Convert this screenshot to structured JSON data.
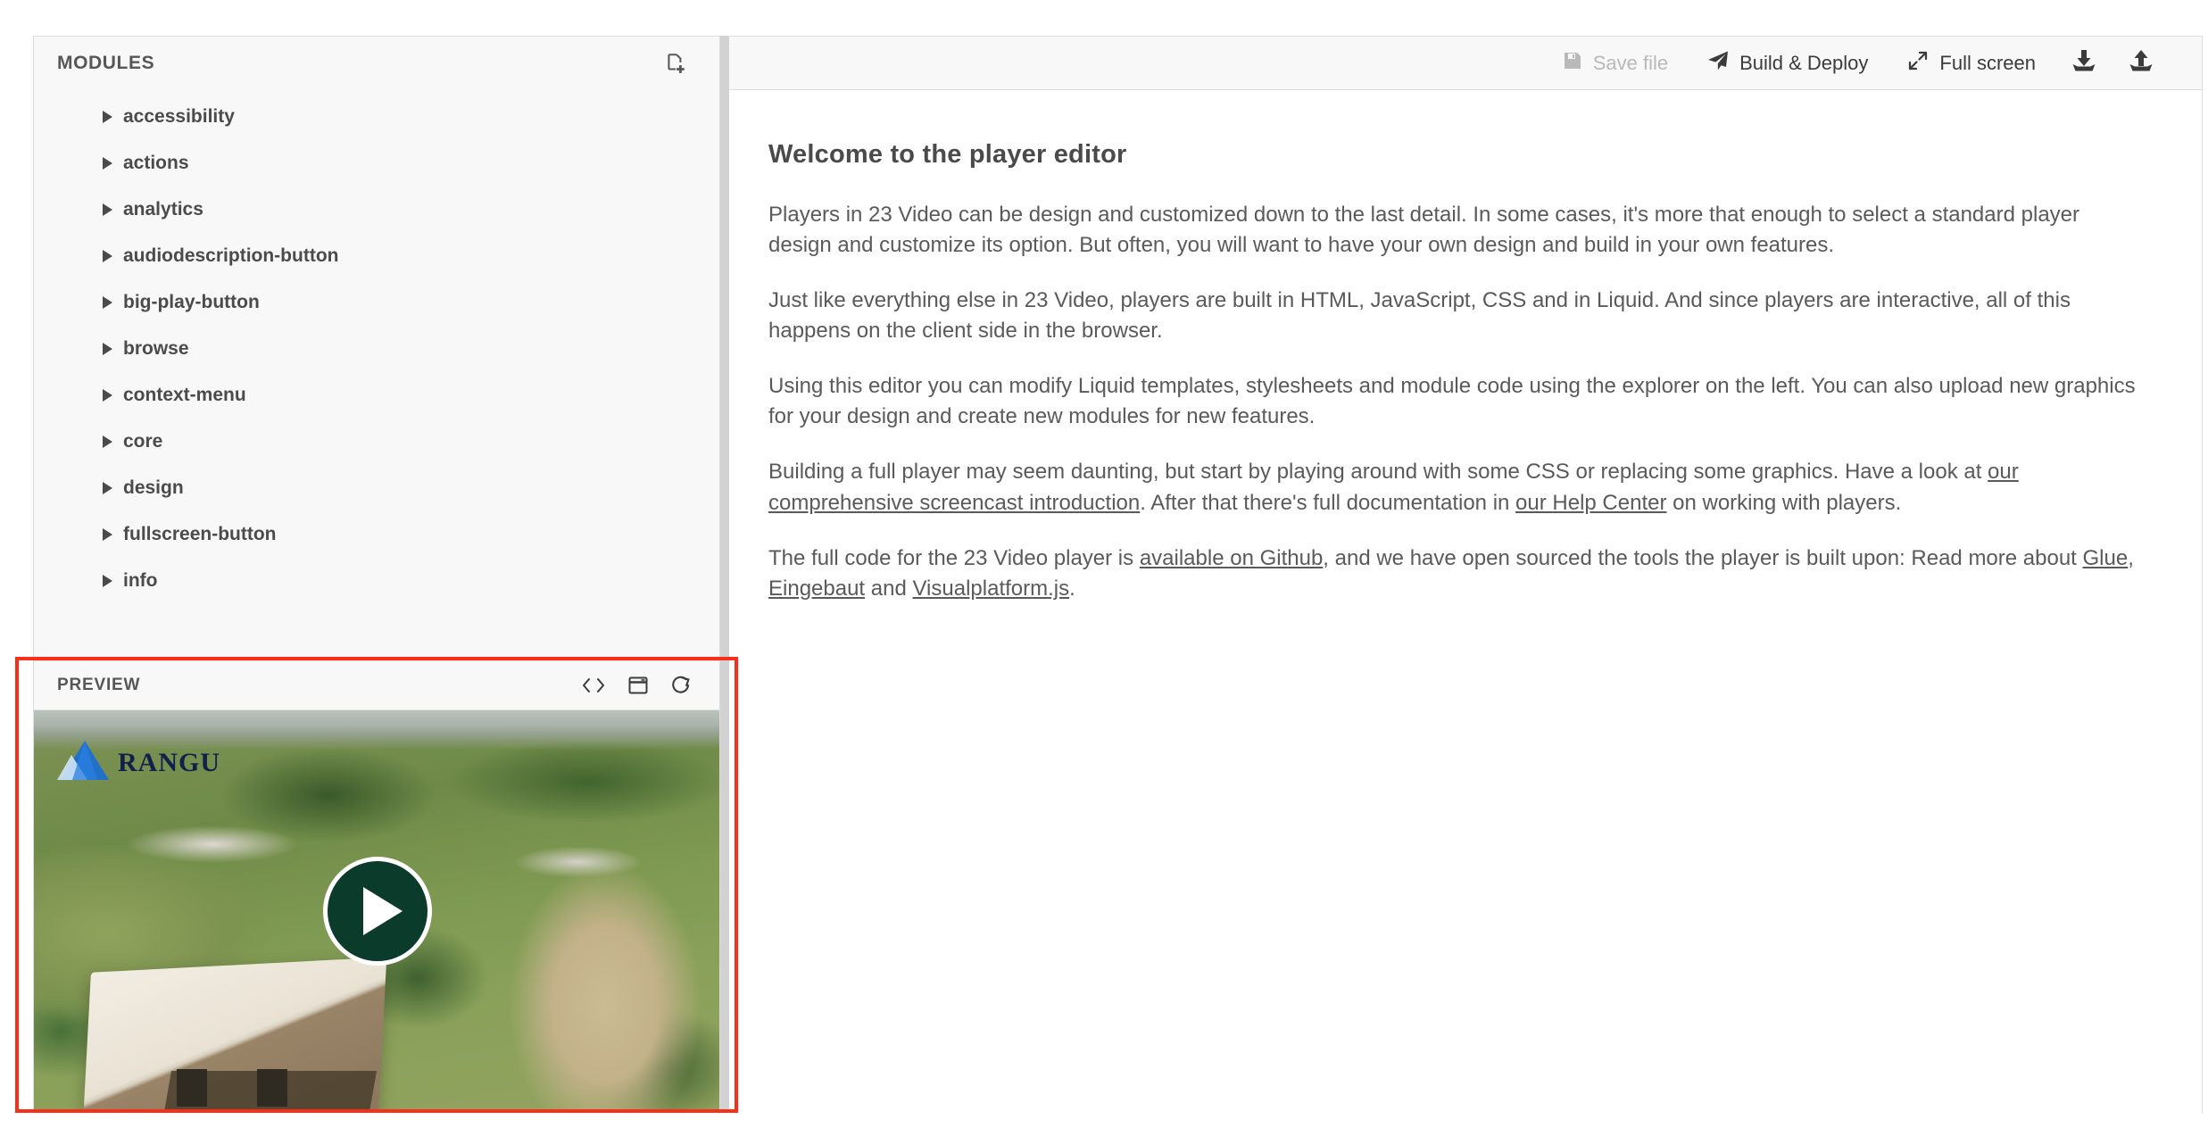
{
  "sidebar": {
    "title": "MODULES",
    "new_module_icon": "new-file-plus-icon",
    "items": [
      {
        "label": "accessibility"
      },
      {
        "label": "actions"
      },
      {
        "label": "analytics"
      },
      {
        "label": "audiodescription-button"
      },
      {
        "label": "big-play-button"
      },
      {
        "label": "browse"
      },
      {
        "label": "context-menu"
      },
      {
        "label": "core"
      },
      {
        "label": "design"
      },
      {
        "label": "fullscreen-button"
      },
      {
        "label": "info"
      }
    ]
  },
  "preview": {
    "title": "PREVIEW",
    "actions": [
      {
        "name": "view-source-icon",
        "glyph": "<>"
      },
      {
        "name": "popout-window-icon",
        "glyph": "window"
      },
      {
        "name": "refresh-icon",
        "glyph": "refresh"
      }
    ],
    "player": {
      "logo_text": "RANGU",
      "play_button_label": "Play",
      "play_button_color": "#0b3b2b"
    },
    "highlight_color": "#f8301a"
  },
  "toolbar": {
    "save_label": "Save file",
    "save_disabled": true,
    "build_label": "Build & Deploy",
    "fullscreen_label": "Full screen",
    "download_icon": "download-icon",
    "upload_icon": "upload-icon"
  },
  "document": {
    "heading": "Welcome to the player editor",
    "p1": "Players in 23 Video can be design and customized down to the last detail. In some cases, it's more that enough to select a standard player design and customize its option. But often, you will want to have your own design and build in your own features.",
    "p2": "Just like everything else in 23 Video, players are built in HTML, JavaScript, CSS and in Liquid. And since players are interactive, all of this happens on the client side in the browser.",
    "p3": "Using this editor you can modify Liquid templates, stylesheets and module code using the explorer on the left. You can also upload new graphics for your design and create new modules for new features.",
    "p4_a": "Building a full player may seem daunting, but start by playing around with some CSS or replacing some graphics. Have a look at ",
    "p4_link1": "our comprehensive screencast introduction",
    "p4_b": ". After that there's full documentation in ",
    "p4_link2": "our Help Center",
    "p4_c": " on working with players.",
    "p5_a": "The full code for the 23 Video player is ",
    "p5_link1": "available on Github",
    "p5_b": ", and we have open sourced the tools the player is built upon: Read more about ",
    "p5_link2": "Glue",
    "p5_c": ", ",
    "p5_link3": "Eingebaut",
    "p5_d": " and ",
    "p5_link4": "Visualplatform.js",
    "p5_e": "."
  }
}
